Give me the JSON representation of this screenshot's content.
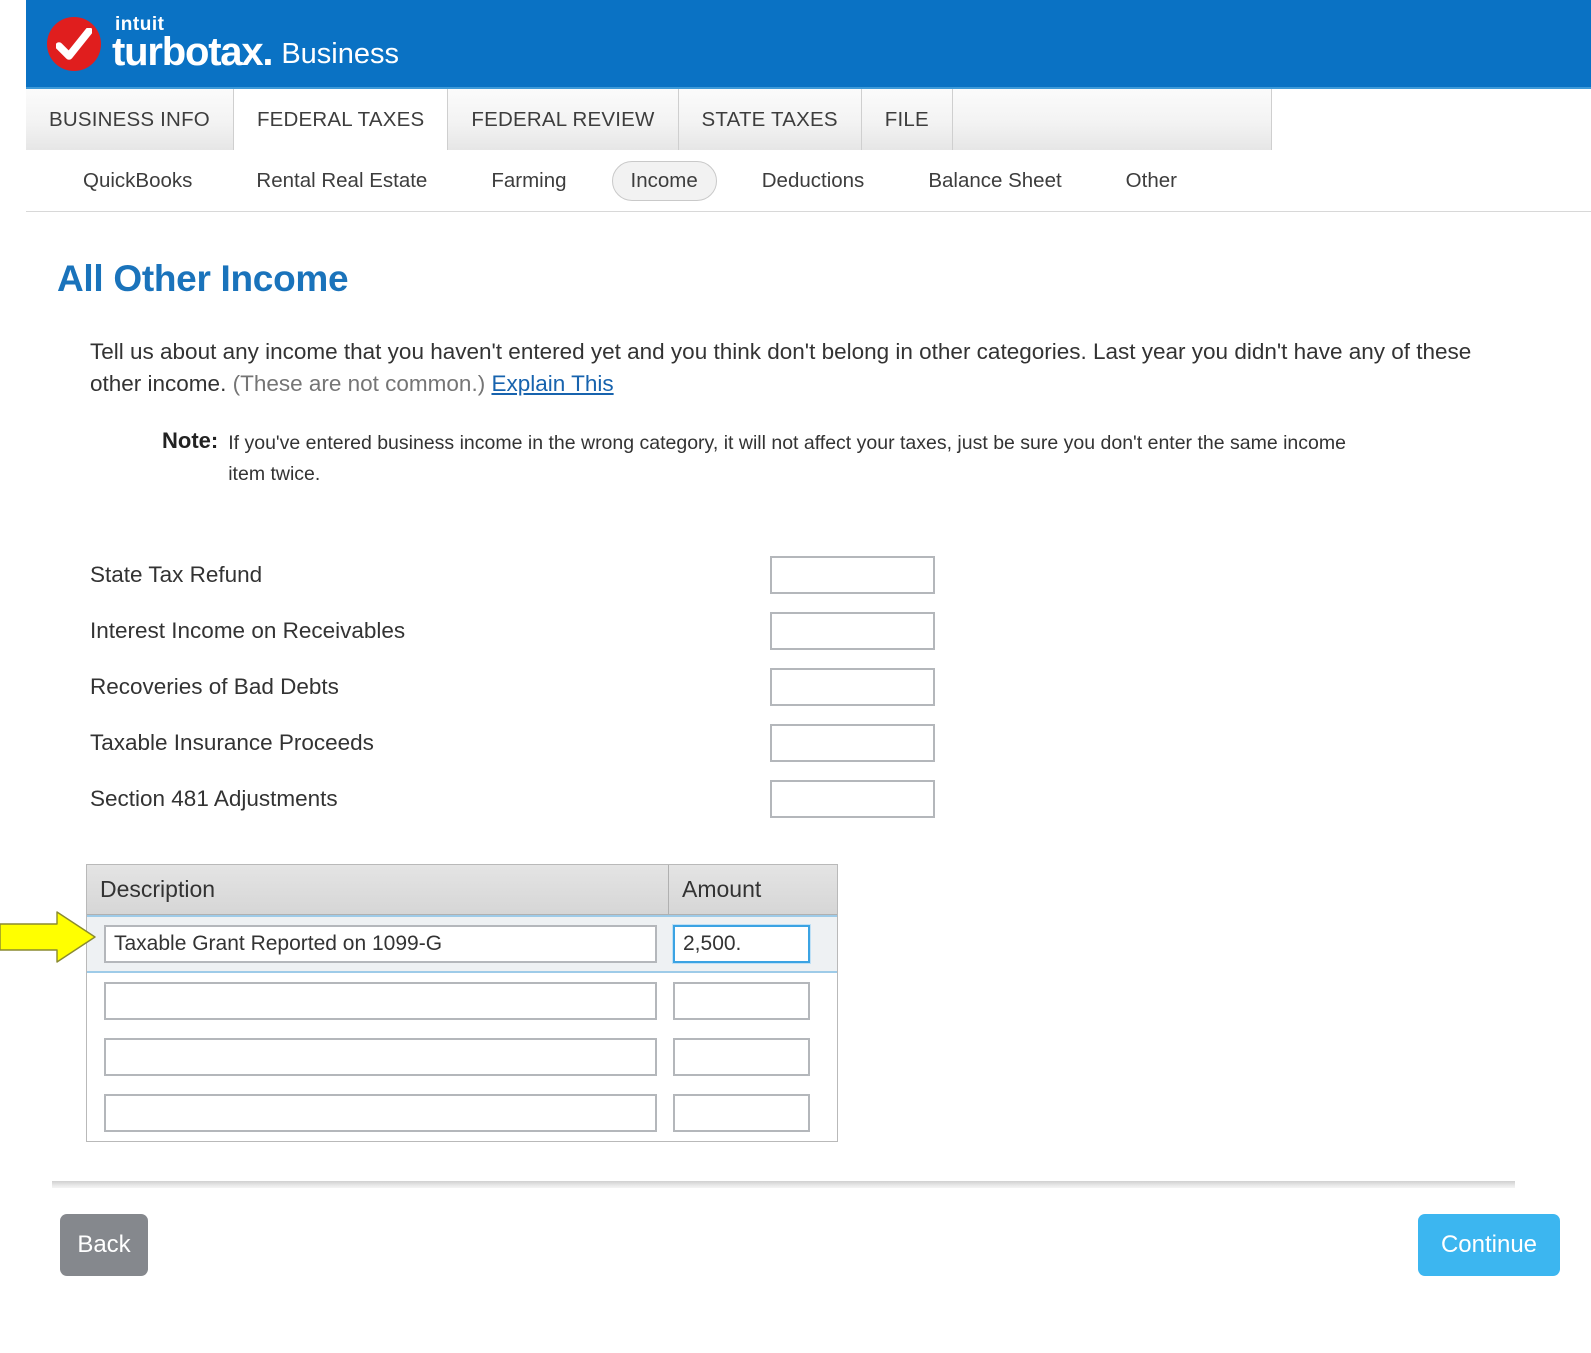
{
  "brand": {
    "intuit": "intuit",
    "product": "turbotax",
    "suffix": ".",
    "edition": "Business",
    "header_color": "#0a72c4",
    "logo_color": "#e01e1e"
  },
  "main_tabs": [
    {
      "label": "BUSINESS INFO",
      "active": false
    },
    {
      "label": "FEDERAL TAXES",
      "active": true
    },
    {
      "label": "FEDERAL REVIEW",
      "active": false
    },
    {
      "label": "STATE TAXES",
      "active": false
    },
    {
      "label": "FILE",
      "active": false
    }
  ],
  "sub_nav": [
    {
      "label": "QuickBooks",
      "active": false
    },
    {
      "label": "Rental Real Estate",
      "active": false
    },
    {
      "label": "Farming",
      "active": false
    },
    {
      "label": "Income",
      "active": true
    },
    {
      "label": "Deductions",
      "active": false
    },
    {
      "label": "Balance Sheet",
      "active": false
    },
    {
      "label": "Other",
      "active": false
    }
  ],
  "page": {
    "title": "All Other Income",
    "title_color": "#1a73bb",
    "intro_main": "Tell us about any income that you haven't entered yet and you think don't belong in other categories. Last year you didn't have any of these other income.",
    "intro_muted": "(These are not common.)",
    "intro_link": "Explain This",
    "note_label": "Note:",
    "note_text": "If you've entered business income in the wrong category, it will not affect your taxes, just be sure you don't enter the same income item twice."
  },
  "fields": [
    {
      "label": "State Tax Refund",
      "value": ""
    },
    {
      "label": "Interest Income on Receivables",
      "value": ""
    },
    {
      "label": "Recoveries of Bad Debts",
      "value": ""
    },
    {
      "label": "Taxable Insurance Proceeds",
      "value": ""
    },
    {
      "label": "Section 481 Adjustments",
      "value": ""
    }
  ],
  "table": {
    "headers": {
      "description": "Description",
      "amount": "Amount"
    },
    "rows": [
      {
        "description": "Taxable Grant Reported on 1099-G",
        "amount": "2,500.",
        "selected": true,
        "amount_focused": true
      },
      {
        "description": "",
        "amount": "",
        "selected": false,
        "amount_focused": false
      },
      {
        "description": "",
        "amount": "",
        "selected": false,
        "amount_focused": false
      },
      {
        "description": "",
        "amount": "",
        "selected": false,
        "amount_focused": false
      }
    ]
  },
  "annotation": {
    "arrow": "right-arrow-highlight",
    "color": "#ffff00"
  },
  "footer": {
    "back_label": "Back",
    "continue_label": "Continue",
    "back_color": "#85888d",
    "continue_color": "#3cb6f0"
  }
}
